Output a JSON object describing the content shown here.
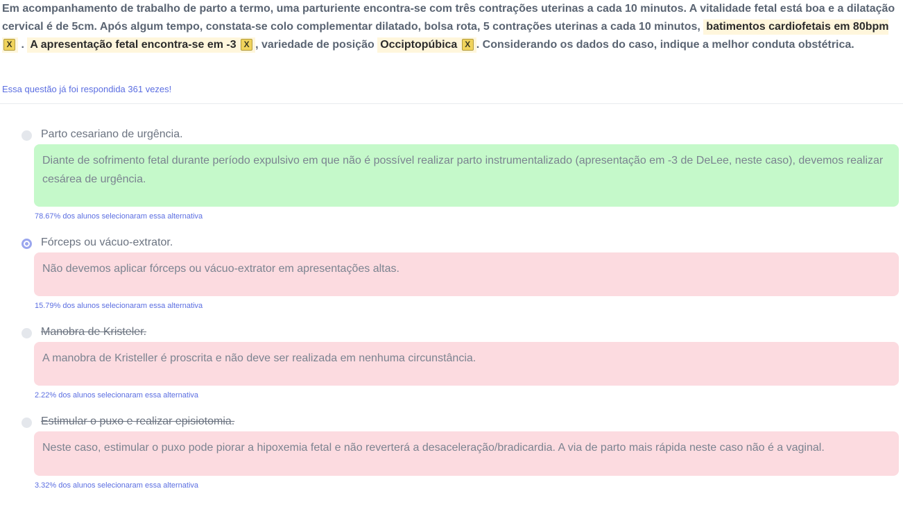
{
  "question": {
    "text_1": "Em acompanhamento de trabalho de parto a termo, uma parturiente encontra-se com três contrações uterinas a cada 10 minutos. A vitalidade fetal está boa e a dilatação cervical é de 5cm. Após algum tempo, constata-se colo complementar dilatado, bolsa rota, 5 contrações uterinas a cada 10 minutos,",
    "highlight_1": "batimentos cardiofetais em 80bpm",
    "sep_1": ".",
    "highlight_2": "A apresentação fetal encontra-se em -3",
    "text_2": ", variedade de posição",
    "highlight_3": "Occiptopúbica",
    "text_3": ". Considerando os dados do caso, indique a melhor conduta obstétrica.",
    "remove_label": "X"
  },
  "answered_text": "Essa questão já foi respondida 361 vezes!",
  "options": [
    {
      "label": "Parto cesariano de urgência.",
      "explanation": "Diante de sofrimento fetal durante período expulsivo em que não é possível realizar parto instrumentalizado (apresentação em -3 de DeLee, neste caso), devemos realizar cesárea de urgência.",
      "stat": "78.67% dos alunos selecionaram essa alternativa",
      "stat_value": 78.67,
      "status": "correct",
      "selected": false,
      "struck": false
    },
    {
      "label": "Fórceps ou vácuo-extrator.",
      "explanation": "Não devemos aplicar fórceps ou vácuo-extrator em apresentações altas.",
      "stat": "15.79% dos alunos selecionaram essa alternativa",
      "stat_value": 15.79,
      "status": "wrong",
      "selected": true,
      "struck": false
    },
    {
      "label": "Manobra de Kristeler.",
      "explanation": "A manobra de Kristeller é proscrita e não deve ser realizada em nenhuma circunstância.",
      "stat": "2.22% dos alunos selecionaram essa alternativa",
      "stat_value": 2.22,
      "status": "wrong",
      "selected": false,
      "struck": true
    },
    {
      "label": "Estimular o puxo e realizar episiotomia.",
      "explanation": "Neste caso, estimular o puxo pode piorar a hipoxemia fetal e não reverterá a desaceleração/bradicardia. A via de parto mais rápida neste caso não é a vaginal.",
      "stat": "3.32% dos alunos selecionaram essa alternativa",
      "stat_value": 3.32,
      "status": "wrong",
      "selected": false,
      "struck": true
    }
  ],
  "colors": {
    "correct_bg": "#c5f9ca",
    "wrong_bg": "#fcdbe0",
    "highlight_bg": "#fff6dc",
    "accent": "#5b6ee1"
  }
}
